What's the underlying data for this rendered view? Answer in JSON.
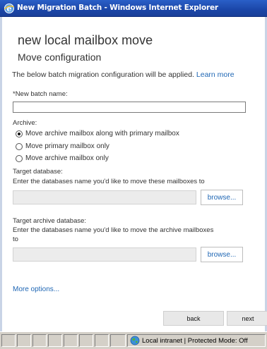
{
  "window": {
    "title": "New Migration Batch - Windows Internet Explorer",
    "icon": "ie-icon"
  },
  "page": {
    "heading": "new local mailbox move",
    "subheading": "Move configuration",
    "intro_text": "The below batch migration configuration will be applied.",
    "learn_more": "Learn more"
  },
  "batch_name": {
    "label": "*New batch name:",
    "value": ""
  },
  "archive": {
    "label": "Archive:",
    "options": [
      {
        "label": "Move archive mailbox along with primary mailbox",
        "checked": true
      },
      {
        "label": "Move primary mailbox only",
        "checked": false
      },
      {
        "label": "Move archive mailbox only",
        "checked": false
      }
    ]
  },
  "target_db": {
    "label": "Target database:",
    "description": "Enter the databases name you'd like to move these mailboxes to",
    "value": "",
    "browse_label": "browse..."
  },
  "target_archive_db": {
    "label": "Target archive database:",
    "description_line1": "Enter the databases name you'd like to move the archive mailboxes",
    "description_line2": "to",
    "value": "",
    "browse_label": "browse..."
  },
  "more_options": "More options...",
  "nav": {
    "back": "back",
    "next": "next"
  },
  "status": {
    "zone": "Local intranet | Protected Mode: Off",
    "icon": "globe-icon"
  }
}
